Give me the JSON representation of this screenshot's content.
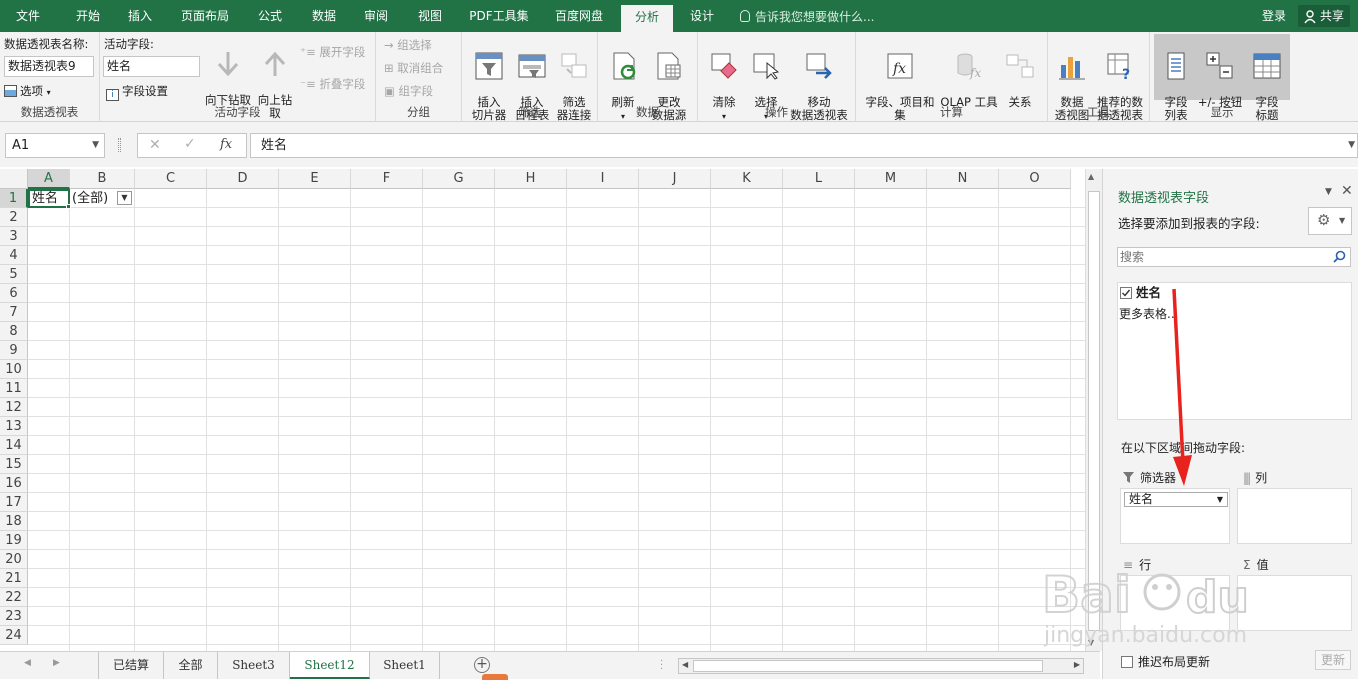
{
  "menu": {
    "tabs": [
      "文件",
      "开始",
      "插入",
      "页面布局",
      "公式",
      "数据",
      "审阅",
      "视图",
      "PDF工具集",
      "百度网盘",
      "分析",
      "设计"
    ],
    "active_tab": "分析",
    "tell_me": "告诉我您想要做什么...",
    "login": "登录",
    "share": "共享"
  },
  "ribbon": {
    "pivot_table_name_label": "数据透视表名称:",
    "pivot_table_name_value": "数据透视表9",
    "options_label": "选项",
    "group1_label": "数据透视表",
    "active_field_label": "活动字段:",
    "active_field_value": "姓名",
    "field_settings_label": "字段设置",
    "drill_down_label": "向下钻取",
    "drill_up_label": "向上钻\n取",
    "expand_field_label": "展开字段",
    "collapse_field_label": "折叠字段",
    "group2_label": "活动字段",
    "group_selection_label": "组选择",
    "ungroup_label": "取消组合",
    "group_field_label": "组字段",
    "group3_label": "分组",
    "insert_slicer_label": "插入\n切片器",
    "insert_timeline_label": "插入\n日程表",
    "filter_connections_label": "筛选\n器连接",
    "group4_label": "筛选",
    "refresh_label": "刷新",
    "change_source_label": "更改\n数据源",
    "group5_label": "数据",
    "clear_label": "清除",
    "select_label": "选择",
    "move_pivot_label": "移动\n数据透视表",
    "group6_label": "操作",
    "fields_items_label": "字段、项目和\n集",
    "olap_label": "OLAP 工具",
    "relationships_label": "关系",
    "group7_label": "计算",
    "pivot_chart_label": "数据\n透视图",
    "recommended_label": "推荐的数\n据透视表",
    "group8_label": "工具",
    "field_list_label": "字段\n列表",
    "buttons_label": "+/- 按钮",
    "field_headers_label": "字段\n标题",
    "group9_label": "显示"
  },
  "formula_bar": {
    "name_box": "A1",
    "content": "姓名"
  },
  "grid": {
    "columns": [
      "A",
      "B",
      "C",
      "D",
      "E",
      "F",
      "G",
      "H",
      "I",
      "J",
      "K",
      "L",
      "M",
      "N",
      "O"
    ],
    "rows": [
      "1",
      "2",
      "3",
      "4",
      "5",
      "6",
      "7",
      "8",
      "9",
      "10",
      "11",
      "12",
      "13",
      "14",
      "15",
      "16",
      "17",
      "18",
      "19",
      "20",
      "21",
      "22",
      "23",
      "24"
    ],
    "a1": "姓名",
    "b1": "(全部)"
  },
  "sheets": [
    "已结算",
    "全部",
    "Sheet3",
    "Sheet12",
    "Sheet1"
  ],
  "active_sheet": "Sheet12",
  "pane": {
    "title": "数据透视表字段",
    "subtitle": "选择要添加到报表的字段:",
    "search_placeholder": "搜索",
    "field_name": "姓名",
    "more_tables": "更多表格...",
    "drag_instruction": "在以下区域间拖动字段:",
    "filters_label": "筛选器",
    "columns_label": "列",
    "rows_label": "行",
    "values_label": "值",
    "filter_item": "姓名",
    "defer_label": "推迟布局更新",
    "update_label": "更新"
  },
  "colors": {
    "accent": "#217346",
    "arrow": "#e8231e"
  }
}
